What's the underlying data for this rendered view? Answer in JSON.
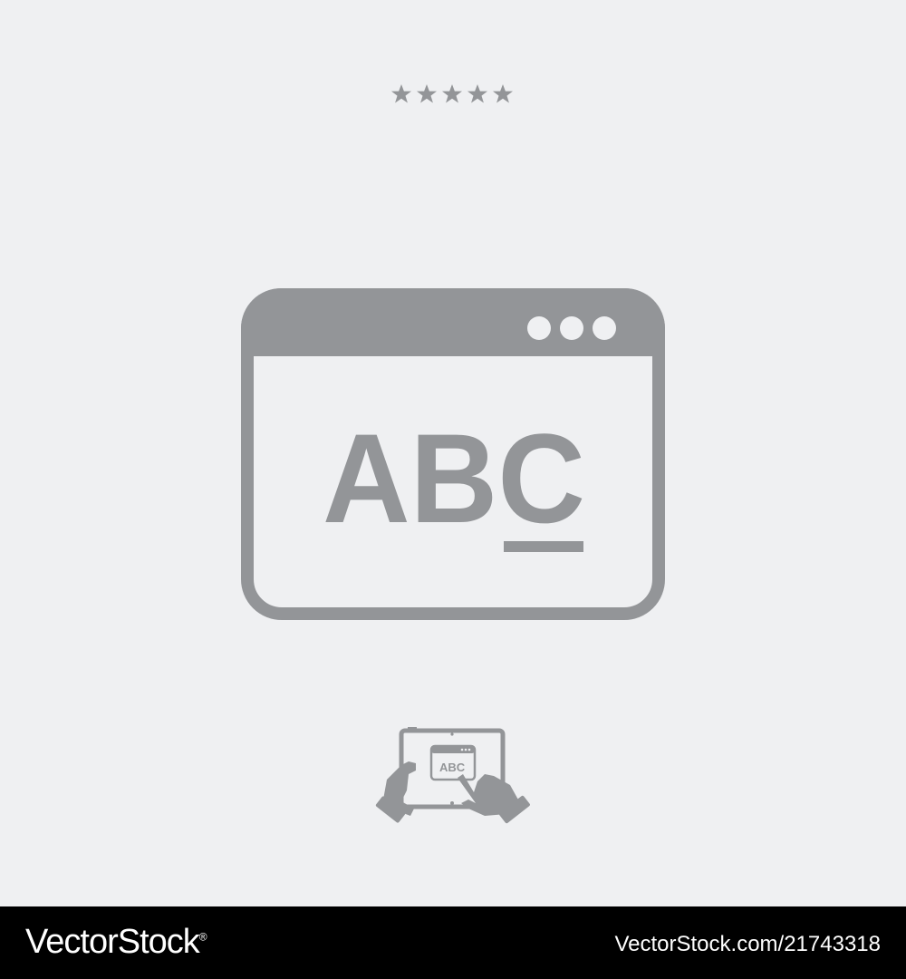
{
  "rating": {
    "stars": 5,
    "icon": "star-icon"
  },
  "colors": {
    "background": "#eff0f2",
    "icon": "#939598",
    "footer": "#000000",
    "footer_text": "#ffffff"
  },
  "main_icon": {
    "name": "browser-window-text-icon",
    "text": "ABC",
    "titlebar_dots": 3
  },
  "small_icon": {
    "name": "tablet-touch-icon",
    "text": "ABC"
  },
  "footer": {
    "brand": "VectorStock",
    "brand_mark": "®",
    "image_id": "VectorStock.com/21743318"
  }
}
